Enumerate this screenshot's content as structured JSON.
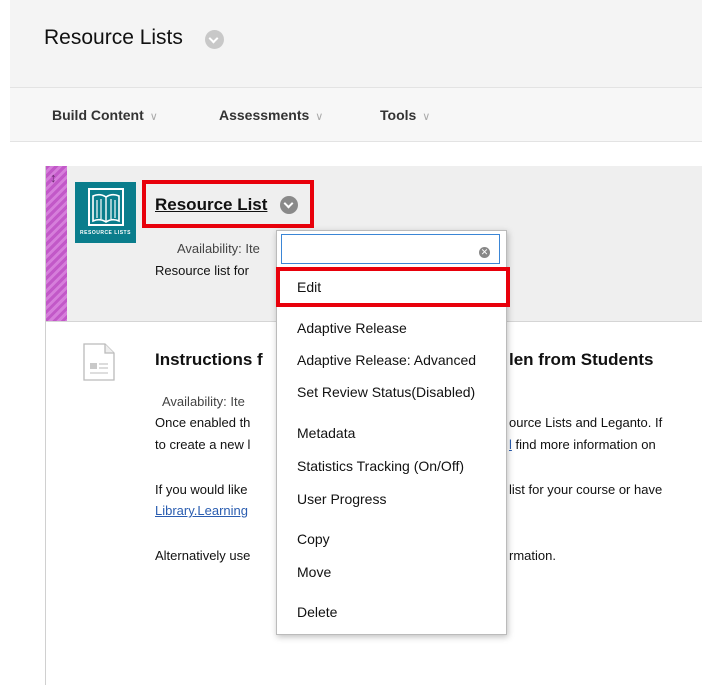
{
  "header": {
    "title": "Resource Lists"
  },
  "toolbar": {
    "items": [
      {
        "label": "Build Content"
      },
      {
        "label": "Assessments"
      },
      {
        "label": "Tools"
      }
    ]
  },
  "item1": {
    "icon_text": "RESOURCE LISTS",
    "title": "Resource List",
    "availability": "Availability:  Ite",
    "description": "Resource list for"
  },
  "item2": {
    "title_left": "Instructions f",
    "title_right": "len from Students",
    "availability": "Availability:  Ite",
    "lines": [
      {
        "left": "Once enabled th",
        "right": "ource Lists and Leganto.  If"
      },
      {
        "left": "to create a new l",
        "right_link": "l",
        "right": " find more information on"
      },
      {
        "left": "If you would like",
        "right": " list for your course or have"
      },
      {
        "left_link": "Library.Learning"
      },
      {
        "left": " Alternatively use",
        "right": "rmation."
      }
    ]
  },
  "context_menu": {
    "search_value": "",
    "items": [
      {
        "label": "Edit"
      },
      {
        "label": "Adaptive Release"
      },
      {
        "label": "Adaptive Release: Advanced"
      },
      {
        "label": "Set Review Status(Disabled)"
      },
      {
        "label": "Metadata"
      },
      {
        "label": "Statistics Tracking (On/Off)"
      },
      {
        "label": "User Progress"
      },
      {
        "label": "Copy"
      },
      {
        "label": "Move"
      },
      {
        "label": "Delete"
      }
    ]
  },
  "colors": {
    "highlight": "#e8000b",
    "handle": "#c258c8",
    "icon_bg": "#0a7d8c",
    "link": "#2a5db0"
  }
}
